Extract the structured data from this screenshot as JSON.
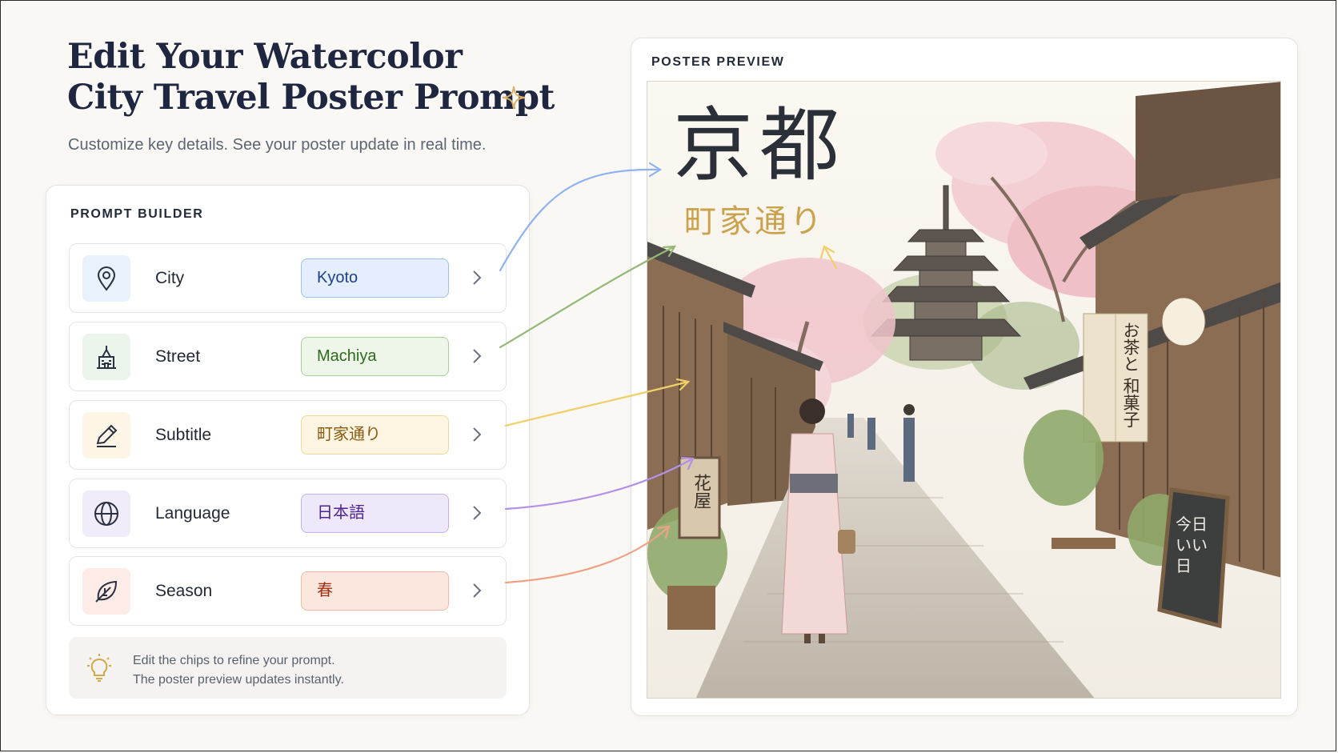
{
  "header": {
    "title_line1": "Edit Your Watercolor",
    "title_line2": "City Travel Poster Prompt",
    "subtitle": "Customize key details. See your poster update in real time."
  },
  "builder": {
    "heading": "PROMPT BUILDER",
    "rows": [
      {
        "label": "City",
        "value": "Kyoto",
        "icon": "location-pin-icon",
        "chip_bg": "#e4eefc",
        "chip_border": "#9fbff0",
        "chip_text": "#1f3f8a",
        "icon_bg": "#e8f1fc"
      },
      {
        "label": "Street",
        "value": "Machiya",
        "icon": "building-icon",
        "chip_bg": "#edf6e8",
        "chip_border": "#a9cf98",
        "chip_text": "#2f6a1e",
        "icon_bg": "#ecf5ec"
      },
      {
        "label": "Subtitle",
        "value": "町家通り",
        "icon": "pen-icon",
        "chip_bg": "#fdf4e1",
        "chip_border": "#efd69a",
        "chip_text": "#8a5a10",
        "icon_bg": "#fdf6e6"
      },
      {
        "label": "Language",
        "value": "日本語",
        "icon": "globe-icon",
        "chip_bg": "#efe8fb",
        "chip_border": "#c4adf0",
        "chip_text": "#4a2590",
        "icon_bg": "#f1ecfa"
      },
      {
        "label": "Season",
        "value": "春",
        "icon": "leaf-icon",
        "chip_bg": "#fce7df",
        "chip_border": "#f1b8a5",
        "chip_text": "#a23010",
        "icon_bg": "#fcebe6"
      }
    ],
    "tip_line1": "Edit the chips to refine your prompt.",
    "tip_line2": "The poster preview updates instantly."
  },
  "preview": {
    "heading": "POSTER PREVIEW",
    "poster_title": "京都",
    "poster_subtitle": "町家通り",
    "noren_text_1": "お茶と",
    "noren_text_2": "和菓子",
    "sign_text": "花屋",
    "board_text": "今日 いい 日"
  },
  "colors": {
    "accent_blue": "#8fb2f0",
    "accent_green": "#93b878",
    "accent_yellow": "#f0cf68",
    "accent_purple": "#b391e6",
    "accent_coral": "#f0a184",
    "sparkle": "#d9b26a"
  }
}
